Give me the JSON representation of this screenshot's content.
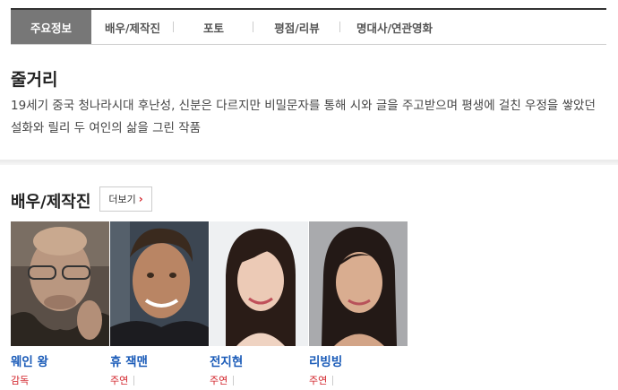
{
  "tabs": [
    {
      "label": "주요정보",
      "active": true
    },
    {
      "label": "배우/제작진",
      "active": false
    },
    {
      "label": "포토",
      "active": false
    },
    {
      "label": "평점/리뷰",
      "active": false
    },
    {
      "label": "명대사/연관영화",
      "active": false
    }
  ],
  "plot": {
    "title": "줄거리",
    "text": "19세기 중국 청나라시대 후난성, 신분은 다르지만 비밀문자를 통해 시와 글을 주고받으며 평생에 걸친 우정을 쌓았던 설화와 릴리 두 여인의 삶을 그린 작품"
  },
  "cast": {
    "title": "배우/제작진",
    "more_label": "더보기",
    "people": [
      {
        "name": "웨인 왕",
        "role": "감독"
      },
      {
        "name": "휴 잭맨",
        "role": "주연"
      },
      {
        "name": "전지현",
        "role": "주연"
      },
      {
        "name": "리빙빙",
        "role": "주연"
      }
    ]
  },
  "colors": {
    "accent": "#d2232a",
    "link": "#1a5bb8",
    "active_tab": "#777777"
  }
}
